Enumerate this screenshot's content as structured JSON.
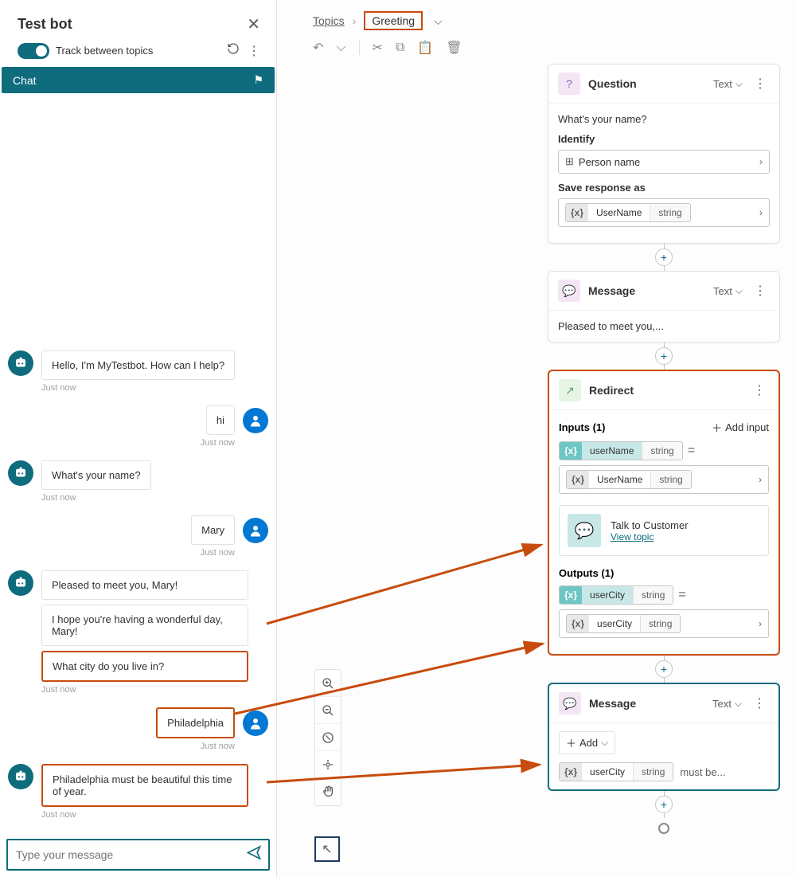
{
  "testPanel": {
    "title": "Test bot",
    "toggleLabel": "Track between topics",
    "chatTab": "Chat",
    "inputPlaceholder": "Type your message",
    "messages": {
      "m1": "Hello, I'm MyTestbot. How can I help?",
      "ts1": "Just now",
      "u1": "hi",
      "tsu1": "Just now",
      "m2": "What's your name?",
      "ts2": "Just now",
      "u2": "Mary",
      "tsu2": "Just now",
      "m3a": "Pleased to meet you, Mary!",
      "m3b": "I hope you're having a wonderful day, Mary!",
      "m3c": "What city do you live in?",
      "ts3": "Just now",
      "u3": "Philadelphia",
      "tsu3": "Just now",
      "m4": "Philadelphia must be beautiful this time of year.",
      "ts4": "Just now"
    }
  },
  "breadcrumb": {
    "root": "Topics",
    "current": "Greeting"
  },
  "question": {
    "title": "Question",
    "meta": "Text",
    "prompt": "What's your name?",
    "identifyLabel": "Identify",
    "identifyValue": "Person name",
    "saveLabel": "Save response as",
    "varName": "UserName",
    "varType": "string"
  },
  "message1": {
    "title": "Message",
    "meta": "Text",
    "text": "Pleased to meet you,..."
  },
  "redirect": {
    "title": "Redirect",
    "inputsLabel": "Inputs (1)",
    "addInput": "Add input",
    "inVarName": "userName",
    "inVarType": "string",
    "inBindName": "UserName",
    "inBindType": "string",
    "targetTitle": "Talk to Customer",
    "targetLink": "View topic",
    "outputsLabel": "Outputs (1)",
    "outVarName": "userCity",
    "outVarType": "string",
    "outBindName": "userCity",
    "outBindType": "string"
  },
  "message2": {
    "title": "Message",
    "meta": "Text",
    "addLabel": "Add",
    "varName": "userCity",
    "varType": "string",
    "suffix": "must be..."
  }
}
